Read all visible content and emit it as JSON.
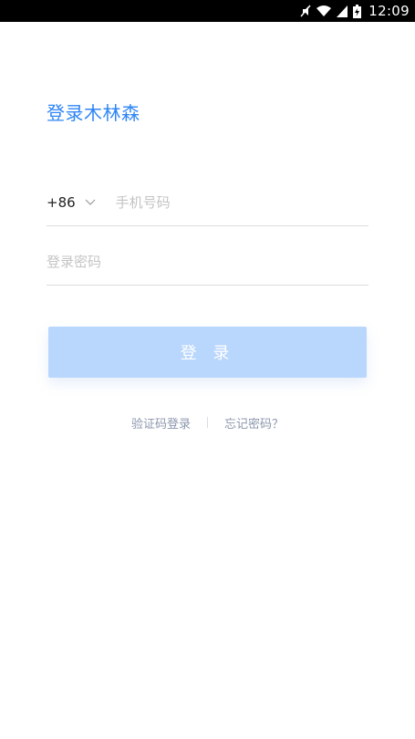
{
  "status_bar": {
    "icons": [
      "mute-icon",
      "wifi-icon",
      "signal-icon",
      "battery-charging-icon"
    ],
    "time": "12:09"
  },
  "title": "登录木林森",
  "phone": {
    "country_code": "+86",
    "placeholder": "手机号码"
  },
  "password": {
    "placeholder": "登录密码"
  },
  "login_button": {
    "label": "登 录",
    "color": "#b9d6fd"
  },
  "links": {
    "sms_login": "验证码登录",
    "forgot_password": "忘记密码？"
  },
  "colors": {
    "accent": "#2f86f6",
    "link": "#8c97ad"
  }
}
